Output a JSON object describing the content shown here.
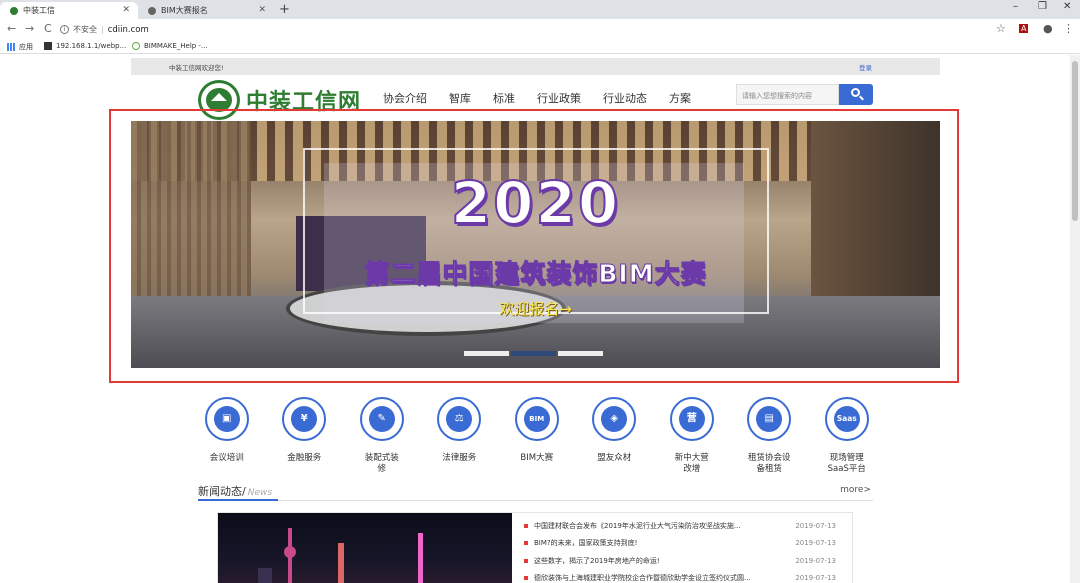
{
  "browser": {
    "tabs": [
      {
        "label": "中装工信",
        "active": true
      },
      {
        "label": "BIM大赛报名",
        "active": false
      }
    ],
    "new_tab": "+",
    "window_controls": [
      "–",
      "❐",
      "✕"
    ],
    "nav": {
      "back": "←",
      "forward": "→",
      "reload": "C"
    },
    "address": {
      "security": "不安全",
      "url": "cdiin.com"
    },
    "bookmarks": [
      {
        "label": "应用"
      },
      {
        "label": "192.168.1.1/webp..."
      },
      {
        "label": "BIMMAKE_Help -..."
      }
    ]
  },
  "site": {
    "topbar": {
      "welcome": "中装工信网欢迎您!",
      "login": "登录"
    },
    "logo_text": "中装工信网",
    "nav": [
      "协会介绍",
      "智库",
      "标准",
      "行业政策",
      "行业动态",
      "方案"
    ],
    "search": {
      "placeholder": "请输入您想搜索的内容"
    },
    "banner": {
      "year": "2020",
      "title": "第二届中国建筑装饰BIM大赛",
      "cta": "欢迎报名→",
      "slide_count": 3,
      "active_slide": 2
    },
    "services": [
      {
        "label": "会议培训",
        "icon": "meeting-icon",
        "glyph": "▣"
      },
      {
        "label": "金融服务",
        "icon": "money-bag-icon",
        "glyph": "¥"
      },
      {
        "label": "装配式装修",
        "icon": "hammer-icon",
        "glyph": "✎"
      },
      {
        "label": "法律服务",
        "icon": "scales-icon",
        "glyph": "⚖"
      },
      {
        "label": "BIM大赛",
        "icon": "bim-icon",
        "glyph": "BIM"
      },
      {
        "label": "盟友众材",
        "icon": "material-icon",
        "glyph": "◈"
      },
      {
        "label": "新中大营改增",
        "icon": "ying-icon",
        "glyph": "营"
      },
      {
        "label": "租赁协会设备租赁",
        "icon": "rental-icon",
        "glyph": "▤"
      },
      {
        "label": "现场管理SaaS平台",
        "icon": "saas-icon",
        "glyph": "Saas"
      }
    ],
    "news": {
      "heading": "新闻动态/",
      "heading_en": "News",
      "more": "more>",
      "items": [
        {
          "title": "中国建材联合会发布《2019年水泥行业大气污染防治攻坚战实施...",
          "date": "2019-07-13"
        },
        {
          "title": "BIM?的未来，国家政策支持到底!",
          "date": "2019-07-13"
        },
        {
          "title": "这些数字，揭示了2019年房地产的命运!",
          "date": "2019-07-13"
        },
        {
          "title": "德欣装饰与上海城建职业学院校企合作暨德欣助学金设立签约仪式圆...",
          "date": "2019-07-13"
        }
      ]
    }
  },
  "colors": {
    "accent": "#3a6bd4",
    "brand_green": "#2e7d32",
    "highlight_red": "#e53935"
  }
}
